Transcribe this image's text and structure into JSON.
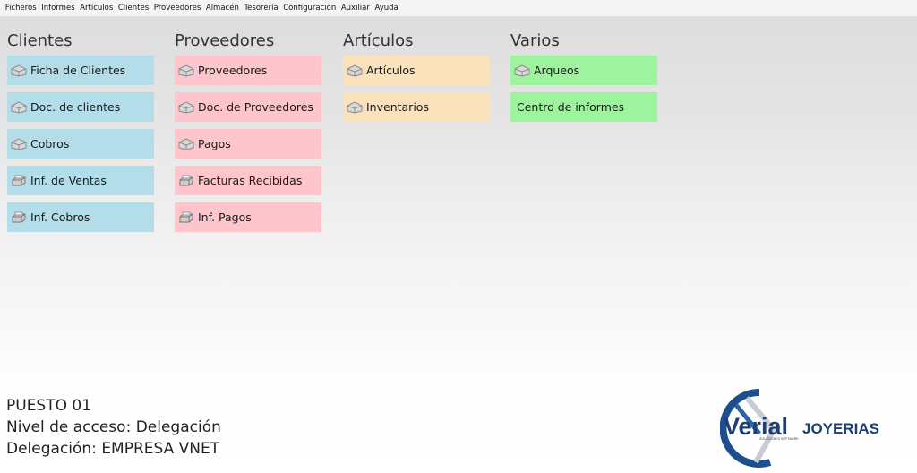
{
  "menu": [
    "Ficheros",
    "Informes",
    "Artículos",
    "Clientes",
    "Proveedores",
    "Almacén",
    "Tesorería",
    "Configuración",
    "Auxiliar",
    "Ayuda"
  ],
  "columns": [
    {
      "title": "Clientes",
      "color": "#b3dde8",
      "tiles": [
        {
          "label": "Ficha de Clientes",
          "icon": "box-icon"
        },
        {
          "label": "Doc. de clientes",
          "icon": "box-icon"
        },
        {
          "label": "Cobros",
          "icon": "box-icon"
        },
        {
          "label": "Inf. de Ventas",
          "icon": "printer-icon"
        },
        {
          "label": "Inf. Cobros",
          "icon": "printer-icon"
        }
      ]
    },
    {
      "title": "Proveedores",
      "color": "#ffc5cd",
      "tiles": [
        {
          "label": "Proveedores",
          "icon": "box-icon"
        },
        {
          "label": "Doc. de Proveedores",
          "icon": "box-icon"
        },
        {
          "label": "Pagos",
          "icon": "box-icon"
        },
        {
          "label": "Facturas Recibidas",
          "icon": "printer-icon"
        },
        {
          "label": "Inf. Pagos",
          "icon": "printer-icon"
        }
      ]
    },
    {
      "title": "Artículos",
      "color": "#fbe2bd",
      "tiles": [
        {
          "label": "Artículos",
          "icon": "box-icon"
        },
        {
          "label": "Inventarios",
          "icon": "box-icon"
        }
      ]
    },
    {
      "title": "Varios",
      "color": "#9ef39e",
      "tiles": [
        {
          "label": "Arqueos",
          "icon": "box-icon"
        },
        {
          "label": "Centro de informes",
          "icon": ""
        }
      ]
    }
  ],
  "footer": {
    "puesto": "PUESTO 01",
    "nivel": "Nivel de acceso: Delegación",
    "delegacion": "Delegación: EMPRESA VNET"
  },
  "logo": {
    "brand": "Verial",
    "product": "JOYERIAS",
    "tagline": "SOLUCIONES SOFTWARE"
  }
}
